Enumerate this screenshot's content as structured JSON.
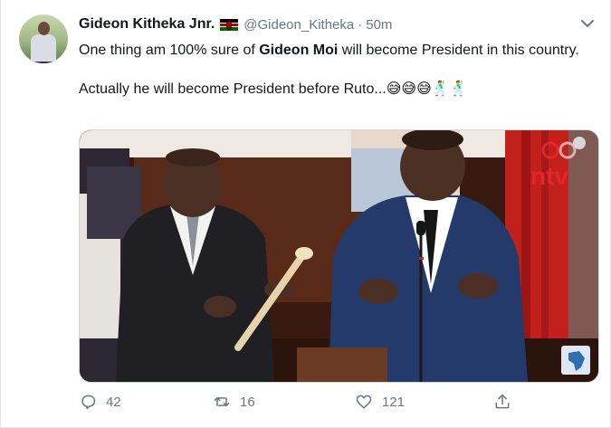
{
  "tweet": {
    "author_name": "Gideon Kitheka Jnr.",
    "flag_icon": "kenya-flag-icon",
    "handle": "@Gideon_Kitheka",
    "separator": "·",
    "time": "50m",
    "text_before": "One thing am 100% sure of ",
    "text_bold": "Gideon Moi",
    "text_after": " will become President in this country.",
    "text_line2": "Actually he will become President before Ruto...😅😅😅🕺🕺",
    "media": {
      "watermark": "ntv",
      "icon": "africa-continent-icon"
    },
    "actions": {
      "reply_count": "42",
      "retweet_count": "16",
      "like_count": "121"
    },
    "colors": {
      "muted": "#657786",
      "text": "#14171a",
      "ntv_red": "#e3262b"
    }
  }
}
